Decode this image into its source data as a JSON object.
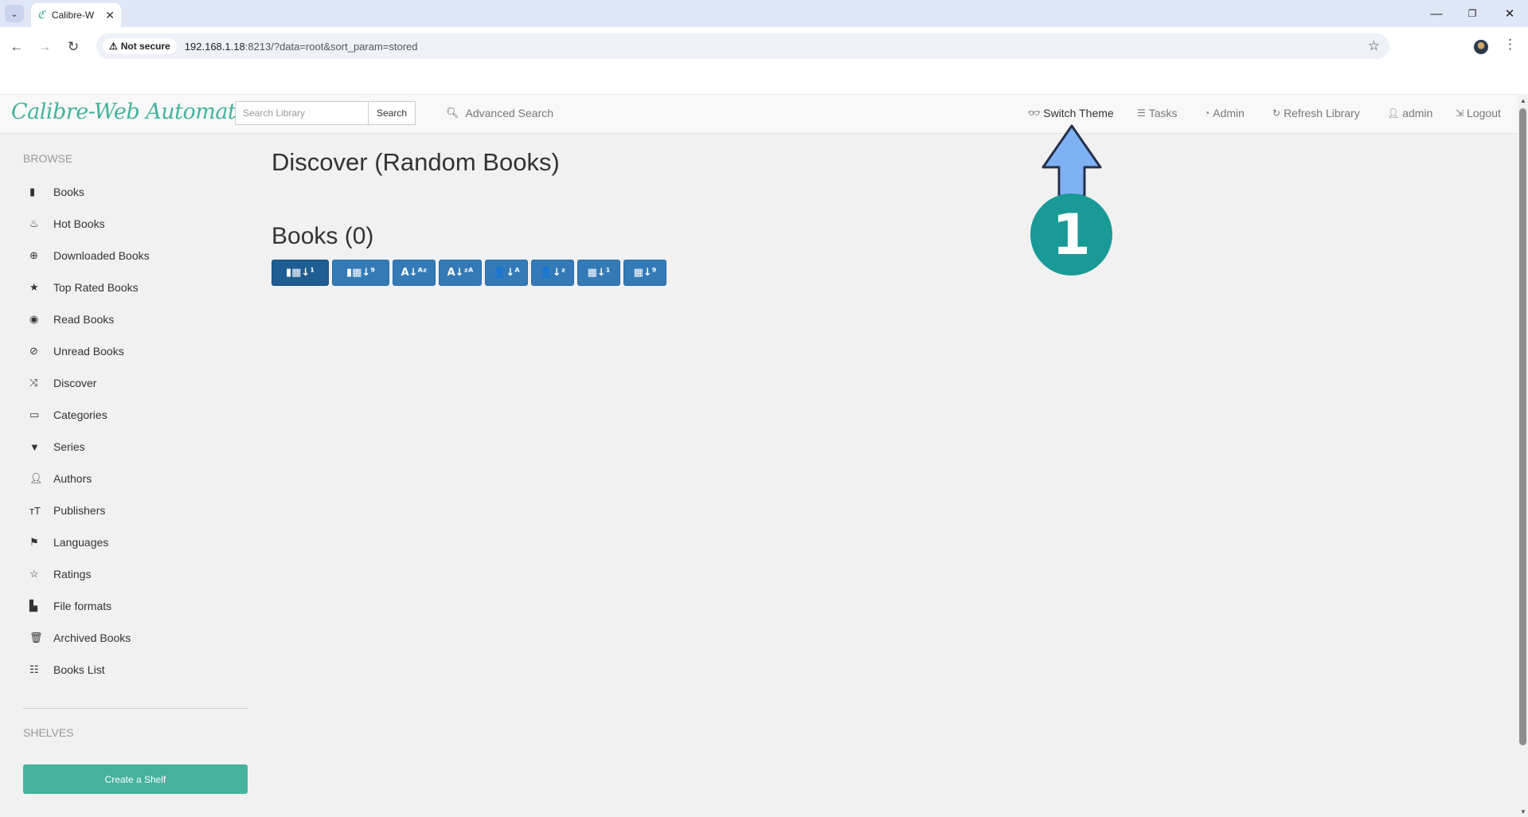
{
  "browser": {
    "tab_title": "Calibre-W",
    "tab_favicon": "ℭ",
    "security_label": "Not secure",
    "url_host": "192.168.1.18",
    "url_rest": ":8213/?data=root&sort_param=stored"
  },
  "app": {
    "brand": "Calibre-Web Automated",
    "search_placeholder": "Search Library",
    "search_button": "Search",
    "advanced_search": "Advanced Search",
    "nav": {
      "switch_theme": "Switch Theme",
      "tasks": "Tasks",
      "admin": "Admin",
      "refresh_library": "Refresh Library",
      "user": "admin",
      "logout": "Logout"
    }
  },
  "sidebar": {
    "browse_heading": "BROWSE",
    "items": [
      {
        "label": "Books",
        "icon": "book-icon"
      },
      {
        "label": "Hot Books",
        "icon": "fire-icon"
      },
      {
        "label": "Downloaded Books",
        "icon": "download-icon"
      },
      {
        "label": "Top Rated Books",
        "icon": "star-icon"
      },
      {
        "label": "Read Books",
        "icon": "eye-icon"
      },
      {
        "label": "Unread Books",
        "icon": "eye-slash-icon"
      },
      {
        "label": "Discover",
        "icon": "shuffle-icon"
      },
      {
        "label": "Categories",
        "icon": "inbox-icon"
      },
      {
        "label": "Series",
        "icon": "bookmark-icon"
      },
      {
        "label": "Authors",
        "icon": "user-icon"
      },
      {
        "label": "Publishers",
        "icon": "text-size-icon"
      },
      {
        "label": "Languages",
        "icon": "flag-icon"
      },
      {
        "label": "Ratings",
        "icon": "star-empty-icon"
      },
      {
        "label": "File formats",
        "icon": "file-icon"
      },
      {
        "label": "Archived Books",
        "icon": "trash-icon"
      },
      {
        "label": "Books List",
        "icon": "list-icon"
      }
    ],
    "shelves_heading": "SHELVES",
    "create_shelf": "Create a Shelf"
  },
  "main": {
    "title": "Discover (Random Books)",
    "books_heading": "Books (0)",
    "sort_buttons": [
      {
        "glyph": "▮▦↓¹",
        "name": "sort-date-new-button"
      },
      {
        "glyph": "▮▦↓⁹",
        "name": "sort-date-old-button"
      },
      {
        "glyph": "A↓ᴬᶻ",
        "name": "sort-title-az-button"
      },
      {
        "glyph": "A↓ᶻᴬ",
        "name": "sort-title-za-button"
      },
      {
        "glyph": "👤↓ᴬ",
        "name": "sort-author-az-button"
      },
      {
        "glyph": "👤↓ᶻ",
        "name": "sort-author-za-button"
      },
      {
        "glyph": "▦↓¹",
        "name": "sort-pubdate-new-button"
      },
      {
        "glyph": "▦↓⁹",
        "name": "sort-pubdate-old-button"
      }
    ]
  },
  "annotation": {
    "step_number": "1",
    "color": "#1a9a97",
    "arrow_color": "#7fb2f5"
  }
}
